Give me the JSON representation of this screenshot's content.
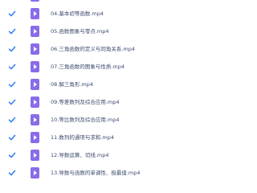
{
  "colors": {
    "checkbox": "#2f7cf6",
    "video_icon": "#8a6ce8",
    "text": "#3c4a6e"
  },
  "icons": {
    "checkbox": "checkbox-checked-icon",
    "file": "video-file-icon"
  },
  "files": [
    {
      "name": "",
      "checked": true
    },
    {
      "name": "04.基本初等函数.mp4",
      "checked": true
    },
    {
      "name": "05.函数图象与零点.mp4",
      "checked": true
    },
    {
      "name": "06.三角函数的定义与同角关系.mp4",
      "checked": true
    },
    {
      "name": "07.三角函数的图象与性质.mp4",
      "checked": true
    },
    {
      "name": "08.解三角形.mp4",
      "checked": true
    },
    {
      "name": "09.等差数列及综合应用.mp4",
      "checked": true
    },
    {
      "name": "10.等比数列及综合应用.mp4",
      "checked": true
    },
    {
      "name": "11.数列的通项与求和.mp4",
      "checked": true
    },
    {
      "name": "12.导数运算、切线.mp4",
      "checked": true
    },
    {
      "name": "13.导数与函数的单调性、极最值.mp4",
      "checked": true
    }
  ]
}
